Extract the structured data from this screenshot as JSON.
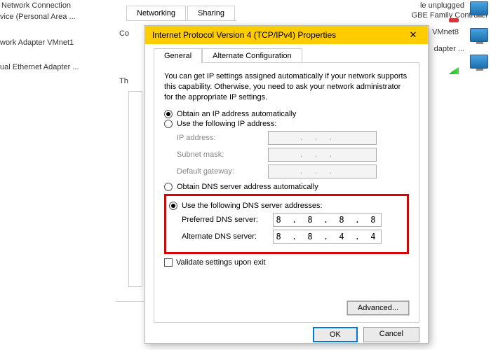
{
  "background": {
    "heading": "Network Connection",
    "device": "vice (Personal Area ...",
    "adapter1": "work Adapter VMnet1",
    "adapter2": "ual Ethernet Adapter ...",
    "tabs": {
      "networking": "Networking",
      "sharing": "Sharing"
    },
    "thLabel": "Th",
    "coLabel": "Co",
    "right": {
      "unplugged": "le unplugged",
      "controller": "GBE Family Controller",
      "vmnet8": "VMnet8",
      "adapter": "dapter ..."
    }
  },
  "dialog": {
    "title": "Internet Protocol Version 4 (TCP/IPv4) Properties",
    "tabs": {
      "general": "General",
      "alt": "Alternate Configuration"
    },
    "description": "You can get IP settings assigned automatically if your network supports this capability. Otherwise, you need to ask your network administrator for the appropriate IP settings.",
    "ip": {
      "auto": "Obtain an IP address automatically",
      "manual": "Use the following IP address:",
      "addr": "IP address:",
      "mask": "Subnet mask:",
      "gateway": "Default gateway:"
    },
    "dns": {
      "auto": "Obtain DNS server address automatically",
      "manual": "Use the following DNS server addresses:",
      "preferred": "Preferred DNS server:",
      "alternate": "Alternate DNS server:",
      "pval": "8 . 8 . 8 . 8",
      "aval": "8 . 8 . 4 . 4"
    },
    "validate": "Validate settings upon exit",
    "advanced": "Advanced...",
    "ok": "OK",
    "cancel": "Cancel"
  }
}
